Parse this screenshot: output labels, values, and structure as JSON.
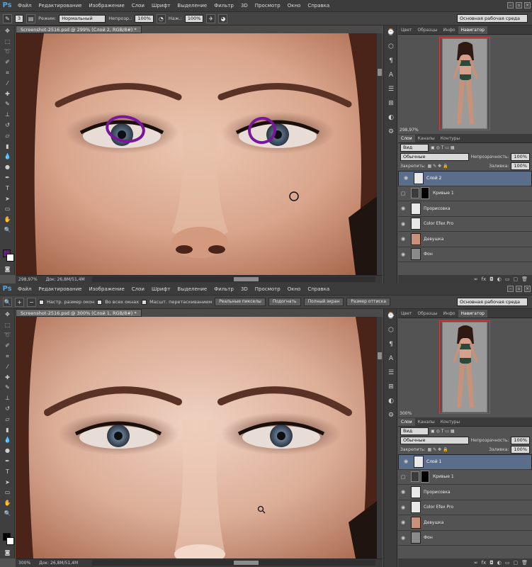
{
  "app": "Ps",
  "menu": [
    "Файл",
    "Редактирование",
    "Изображение",
    "Слои",
    "Шрифт",
    "Выделение",
    "Фильтр",
    "3D",
    "Просмотр",
    "Окно",
    "Справка"
  ],
  "workspace": "Основная рабочая среда",
  "top": {
    "options": {
      "mode_label": "Режим:",
      "mode_value": "Нормальный",
      "opacity_label": "Непрозр.:",
      "opacity_value": "100%",
      "flow_label": "Наж.:",
      "flow_value": "100%",
      "brush_size": "3"
    },
    "doc_tab": "Screenshot-2516.psd @ 299% (Слой 2, RGB/8#) *",
    "status": {
      "zoom": "298,97%",
      "doc": "Док: 26,8M/51,4M"
    },
    "navigator": {
      "tabs": [
        "Цвет",
        "Образцы",
        "Инфо",
        "Навигатор"
      ],
      "zoom": "298,97%"
    },
    "layers": {
      "tabs": [
        "Слои",
        "Каналы",
        "Контуры"
      ],
      "kind": "Вид",
      "blend": "Обычные",
      "opacity_label": "Непрозрачность:",
      "opacity_value": "100%",
      "lock_label": "Закрепить:",
      "fill_label": "Заливка:",
      "fill_value": "100%",
      "items": [
        {
          "name": "Слой 2",
          "selected": true
        },
        {
          "name": "Кривые 1",
          "selected": false,
          "adjust": true
        },
        {
          "name": "Прорисовка",
          "selected": false
        },
        {
          "name": "Color Efex Pro",
          "selected": false
        },
        {
          "name": "Девушка",
          "selected": false
        },
        {
          "name": "Фон",
          "selected": false
        }
      ]
    }
  },
  "bottom": {
    "options": {
      "resize": "Настр. размер окон",
      "all_windows": "Во всех окнах",
      "scrubby": "Масшт. перетаскиванием",
      "actual": "Реальные пикселы",
      "fit": "Подогнать",
      "fill": "Полный экран",
      "print": "Размер оттиска"
    },
    "doc_tab": "Screenshot-2516.psd @ 300% (Слой 1, RGB/8#) *",
    "status": {
      "zoom": "300%",
      "doc": "Док: 26,8M/51,4M"
    },
    "navigator": {
      "tabs": [
        "Цвет",
        "Образцы",
        "Инфо",
        "Навигатор"
      ],
      "zoom": "300%"
    },
    "layers": {
      "tabs": [
        "Слои",
        "Каналы",
        "Контуры"
      ],
      "kind": "Вид",
      "blend": "Обычные",
      "opacity_label": "Непрозрачность:",
      "opacity_value": "100%",
      "lock_label": "Закрепить:",
      "fill_label": "Заливка:",
      "fill_value": "100%",
      "items": [
        {
          "name": "Слой 1",
          "selected": true
        },
        {
          "name": "Кривые 1",
          "selected": false,
          "adjust": true
        },
        {
          "name": "Прорисовка",
          "selected": false
        },
        {
          "name": "Color Efex Pro",
          "selected": false
        },
        {
          "name": "Девушка",
          "selected": false
        },
        {
          "name": "Фон",
          "selected": false
        }
      ]
    }
  },
  "colors": {
    "foreground_top": "#6b1a7d",
    "background": "#ffffff",
    "foreground_bottom": "#000000",
    "accent": "#5a6e8c"
  }
}
